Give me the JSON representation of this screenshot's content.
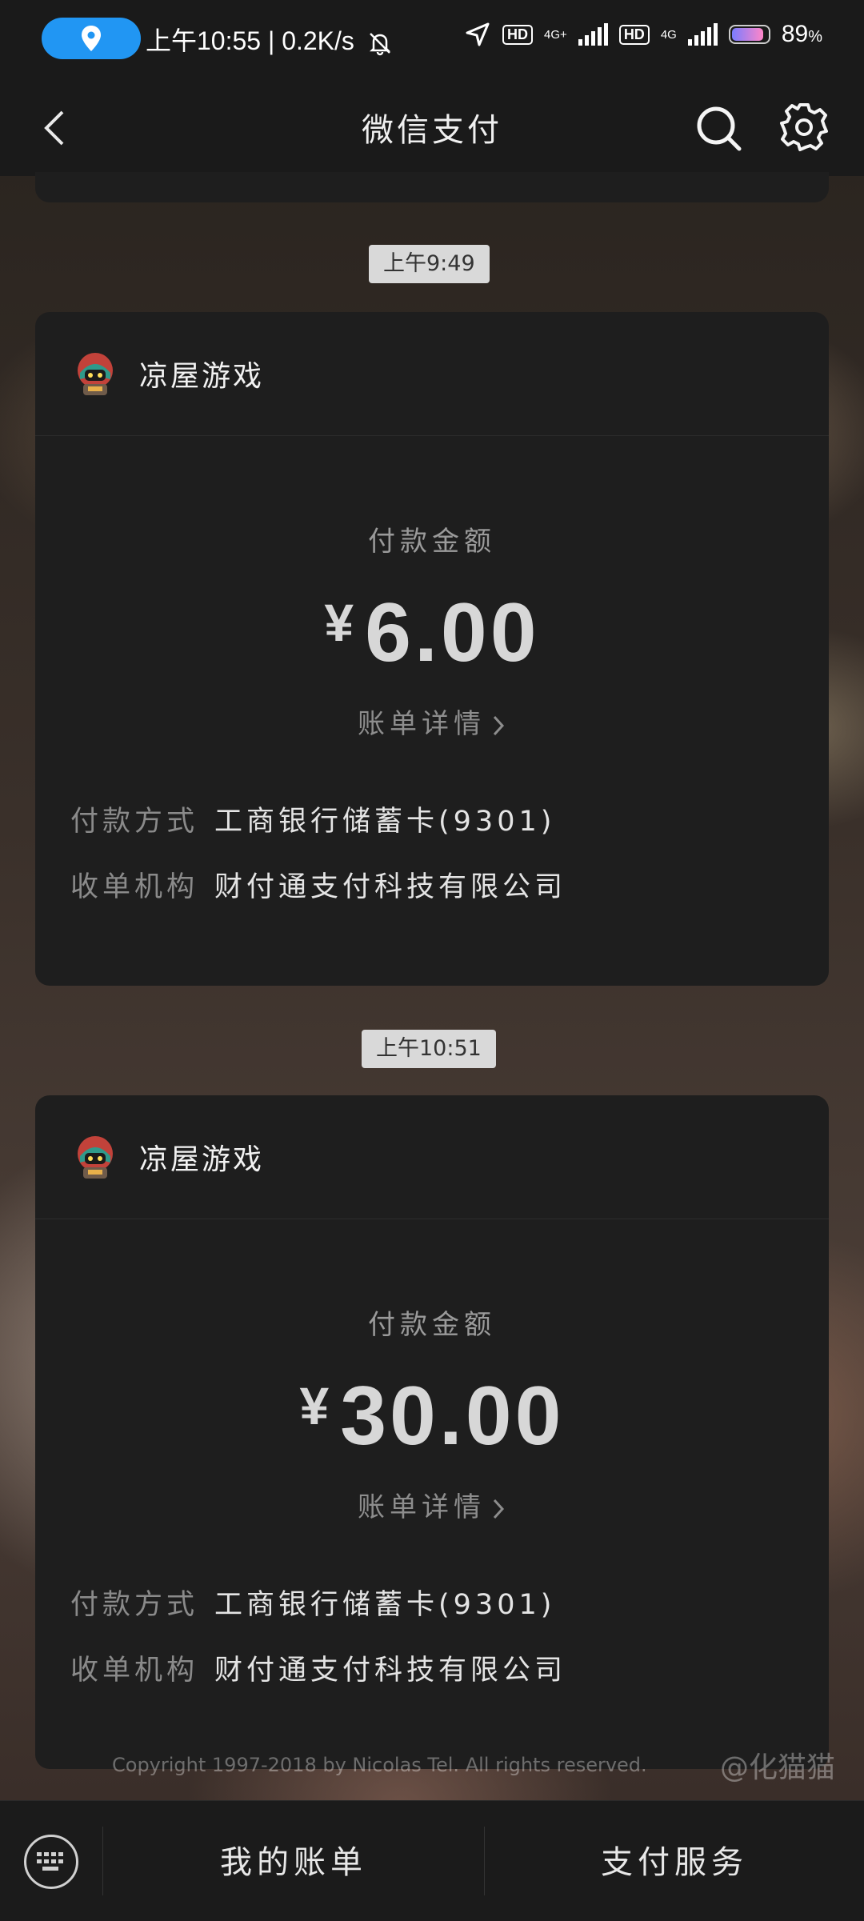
{
  "status_bar": {
    "time": "上午10:55",
    "speed": "0.2K/s",
    "hd1": "HD",
    "net1": "4G+",
    "hd2": "HD",
    "net2": "4G",
    "battery": "89",
    "battery_unit": "%",
    "battery_level": 0.89
  },
  "header": {
    "title": "微信支付"
  },
  "messages": [
    {
      "time": "上午9:49",
      "merchant": "凉屋游戏",
      "amount_label": "付款金额",
      "currency": "¥",
      "amount": "6.00",
      "detail_link": "账单详情",
      "pay_method_label": "付款方式",
      "pay_method": "工商银行储蓄卡(9301)",
      "acquirer_label": "收单机构",
      "acquirer": "财付通支付科技有限公司"
    },
    {
      "time": "上午10:51",
      "merchant": "凉屋游戏",
      "amount_label": "付款金额",
      "currency": "¥",
      "amount": "30.00",
      "detail_link": "账单详情",
      "pay_method_label": "付款方式",
      "pay_method": "工商银行储蓄卡(9301)",
      "acquirer_label": "收单机构",
      "acquirer": "财付通支付科技有限公司"
    }
  ],
  "watermark": {
    "copyright": "Copyright 1997-2018 by Nicolas Tel. All rights reserved.",
    "weibo": "@化猫猫"
  },
  "bottom_bar": {
    "tab1": "我的账单",
    "tab2": "支付服务"
  }
}
